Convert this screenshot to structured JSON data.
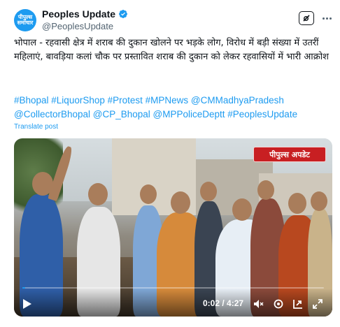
{
  "author": {
    "display_name": "Peoples Update",
    "handle": "@PeoplesUpdate",
    "avatar_text": "पीपुल्स समाचार",
    "verified": true
  },
  "tweet": {
    "text": "भोपाल - रहवासी क्षेत्र में शराब की दुकान खोलने पर भड़के लोग, विरोध में बड़ी संख्या में उतरीं महिलाएं, बावड़िया कलां चौक पर प्रस्तावित शराब की दुकान को लेकर रहवासियों में भारी आक्रोश",
    "hashtags": "#Bhopal #LiquorShop #Protest #MPNews @CMMadhyaPradesh @CollectorBhopal @CP_Bhopal @MPPoliceDeptt #PeoplesUpdate",
    "translate_label": "Translate post"
  },
  "video": {
    "badge_text": "पीपुल्स अपडेट",
    "current_time": "0:02",
    "duration": "4:27",
    "time_display": "0:02 / 4:27",
    "progress": 0.01
  },
  "icons": {
    "grok": "grok-icon",
    "more": "more-icon",
    "play": "play-icon",
    "volume": "volume-icon",
    "settings": "settings-icon",
    "pip": "pip-icon",
    "fullscreen": "fullscreen-icon"
  },
  "colors": {
    "accent": "#1d9bf0",
    "badge": "#c81f22",
    "text": "#0f1419",
    "muted": "#536471"
  }
}
